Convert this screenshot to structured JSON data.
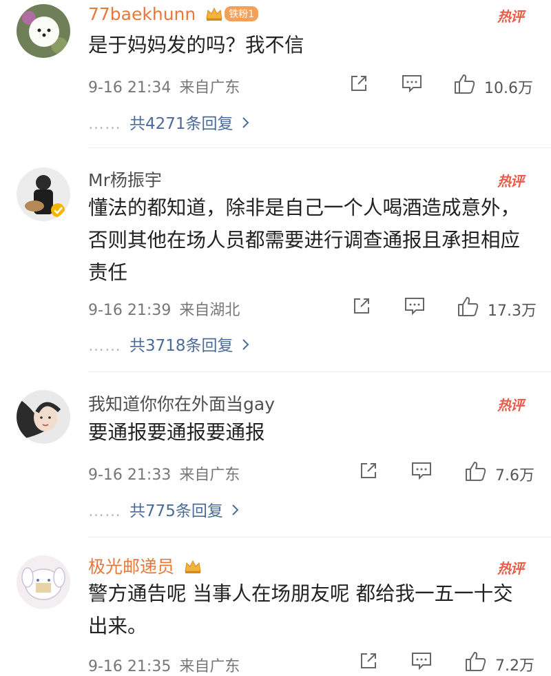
{
  "hot_label": "热评",
  "icons": {
    "share": "share-icon",
    "comment": "comment-icon",
    "like": "thumbs-up-icon",
    "crown": "crown-icon",
    "chevron": "chevron-right-icon"
  },
  "comments": [
    {
      "username": "77baekhunn",
      "fan_badge": "铁粉1",
      "text": "是于妈妈发的吗？我不信",
      "time": "9-16 21:34",
      "location": "来自广东",
      "likes": "10.6万",
      "replies_dots": "……",
      "replies": "共4271条回复"
    },
    {
      "username": "Mr杨振宇",
      "text": "懂法的都知道，除非是自己一个人喝酒造成意外，否则其他在场人员都需要进行调查通报且承担相应责任",
      "time": "9-16 21:39",
      "location": "来自湖北",
      "likes": "17.3万",
      "replies_dots": "……",
      "replies": "共3718条回复"
    },
    {
      "username": "我知道你你在外面当gay",
      "text": "要通报要通报要通报",
      "time": "9-16 21:33",
      "location": "来自广东",
      "likes": "7.6万",
      "replies_dots": "……",
      "replies": "共775条回复"
    },
    {
      "username": "极光邮递员",
      "text": "警方通告呢 当事人在场朋友呢 都给我一五一十交出来。",
      "time": "9-16 21:35",
      "location": "来自广东",
      "likes": "7.2万"
    }
  ]
}
